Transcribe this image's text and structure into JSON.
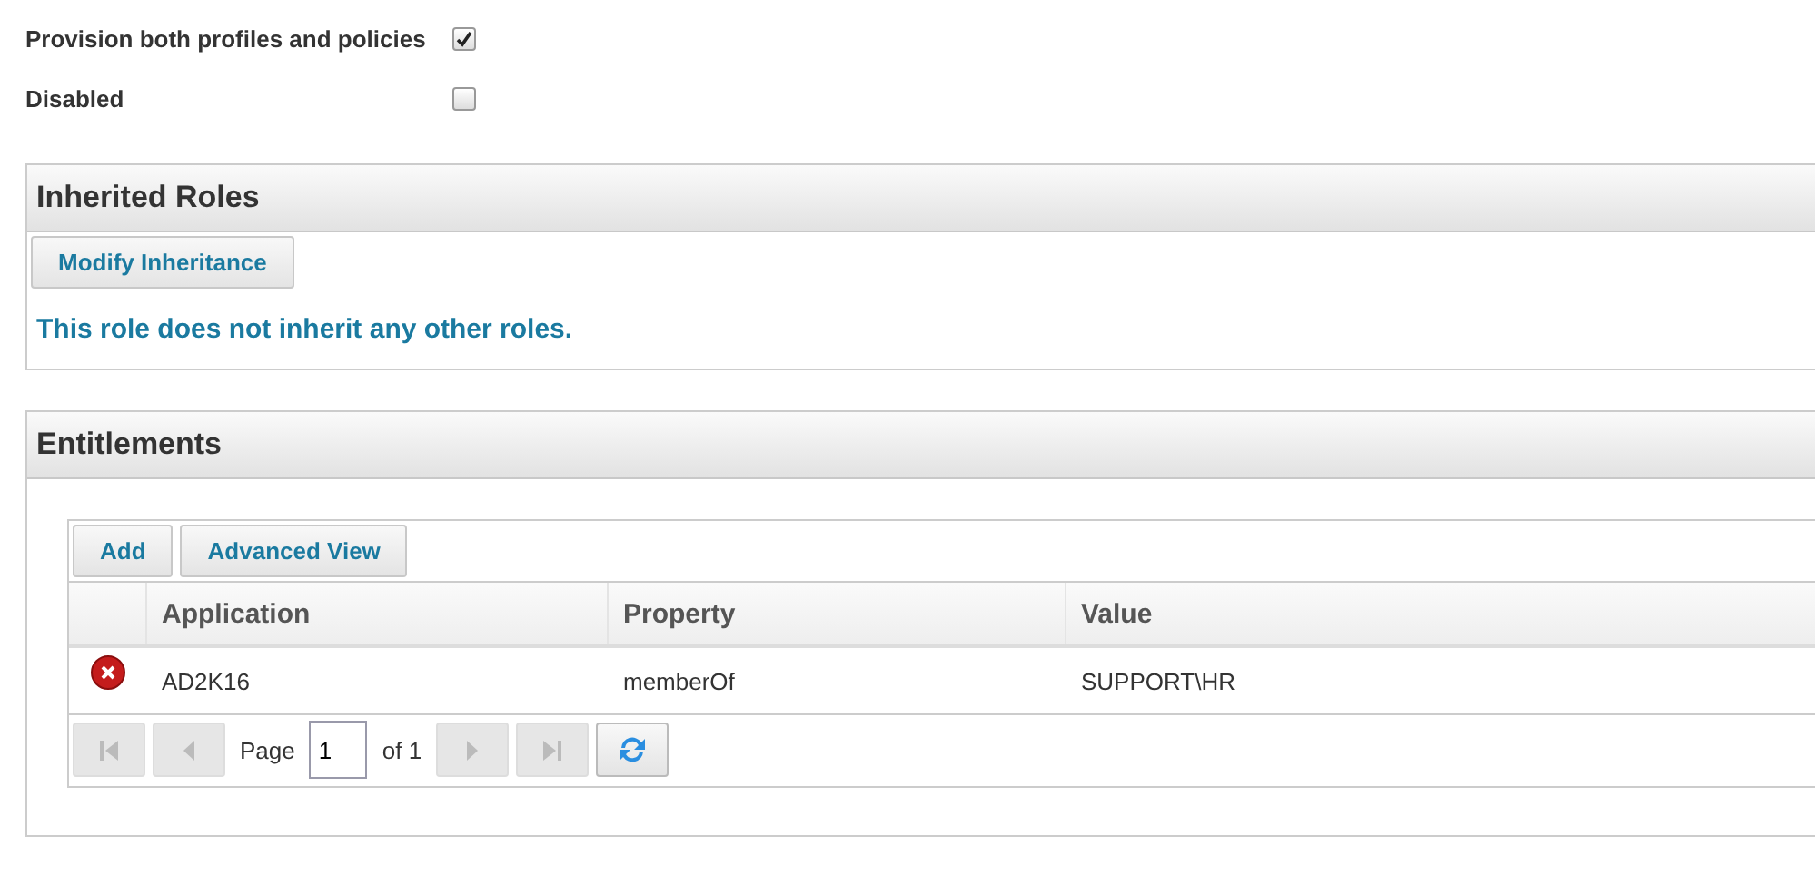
{
  "options": [
    {
      "label": "Provision both profiles and policies",
      "checked": true
    },
    {
      "label": "Disabled",
      "checked": false
    }
  ],
  "inherited_roles": {
    "title": "Inherited Roles",
    "button": "Modify Inheritance",
    "message": "This role does not inherit any other roles."
  },
  "entitlements": {
    "title": "Entitlements",
    "toolbar": [
      "Add",
      "Advanced View"
    ],
    "columns": [
      "Application",
      "Property",
      "Value"
    ],
    "rows": [
      {
        "cells": [
          "AD2K16",
          "memberOf",
          "SUPPORT\\HR"
        ]
      }
    ],
    "pager": {
      "buttons": [
        {
          "kind": "first",
          "disabled": true
        },
        {
          "kind": "prev",
          "disabled": true
        },
        {
          "kind": "next",
          "disabled": true
        },
        {
          "kind": "last",
          "disabled": true
        },
        {
          "kind": "refresh",
          "disabled": false
        }
      ],
      "page_label": "Page",
      "page_value": "1",
      "of_label": "of 1"
    }
  }
}
